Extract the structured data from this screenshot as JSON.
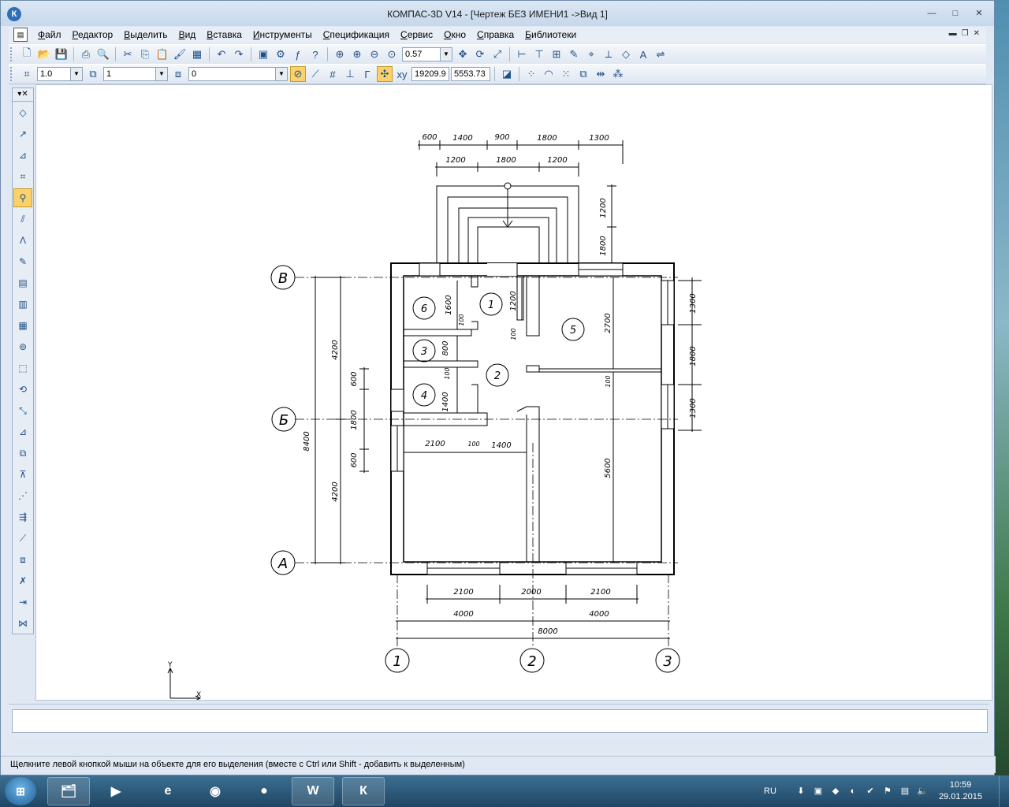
{
  "window": {
    "title": "КОМПАС-3D V14 - [Чертеж БЕЗ ИМЕНИ1 ->Вид 1]",
    "app_icon": "К",
    "buttons": {
      "minimize": "—",
      "maximize": "□",
      "close": "✕"
    }
  },
  "menu": [
    "Файл",
    "Редактор",
    "Выделить",
    "Вид",
    "Вставка",
    "Инструменты",
    "Спецификация",
    "Сервис",
    "Окно",
    "Справка",
    "Библиотеки"
  ],
  "toolbar1": {
    "zoom_value": "0.57"
  },
  "toolbar2": {
    "scale_value": "1.0",
    "style_value": "1",
    "layer_value": "0",
    "coord_x": "19209.9",
    "coord_y": "5553.73"
  },
  "drawing": {
    "axis_letters": [
      "В",
      "Б",
      "А"
    ],
    "axis_numbers": [
      "1",
      "2",
      "3"
    ],
    "rooms": [
      "1",
      "2",
      "3",
      "4",
      "5",
      "6"
    ],
    "dims_top_row1": [
      "600",
      "1400",
      "900",
      "1800",
      "1300"
    ],
    "dims_top_row2": [
      "1200",
      "1800",
      "1200"
    ],
    "dims_bottom_row1": [
      "2100",
      "2000",
      "2100"
    ],
    "dims_bottom_row2": [
      "4000",
      "4000"
    ],
    "dims_bottom_total": "8000",
    "dims_left_outer": [
      "4200",
      "4200"
    ],
    "dims_left_total": "8400",
    "dims_left_inner": [
      "600",
      "1800",
      "600"
    ],
    "dims_right": [
      "1300",
      "1800",
      "1300"
    ],
    "dims_porch": [
      "1200",
      "1800"
    ],
    "dims_interior": {
      "d_2100": "2100",
      "d_100": "100",
      "d_1400": "1400",
      "d_1600": "1600",
      "d_100a": "100",
      "d_800": "800",
      "d_100b": "100",
      "d_1400b": "1400",
      "d_1200": "1200",
      "d_100c": "100",
      "d_2700": "2700",
      "d_100d": "100",
      "d_5600": "5600"
    },
    "ucs_labels": {
      "x": "X",
      "y": "Y"
    }
  },
  "status_text": "Щелкните левой кнопкой мыши на объекте для его выделения (вместе с Ctrl или Shift - добавить к выделенным)",
  "taskbar": {
    "lang": "RU",
    "time": "10:59",
    "date": "29.01.2015",
    "word_label": "W",
    "kompas_label": "К"
  }
}
